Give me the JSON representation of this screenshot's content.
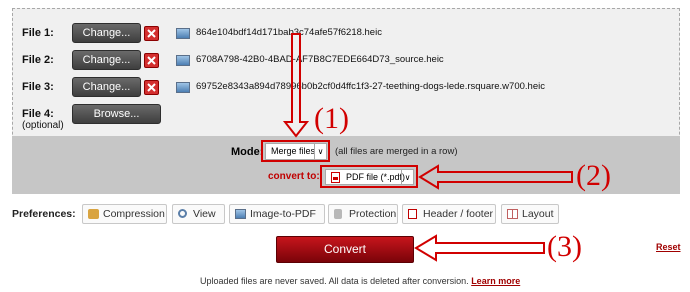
{
  "files": [
    {
      "label": "File 1:",
      "button": "Change...",
      "filename": "864e104bdf14d171bab3c74afe57f6218.heic"
    },
    {
      "label": "File 2:",
      "button": "Change...",
      "filename": "6708A798-42B0-4BAD-AF7B8C7EDE664D73_source.heic"
    },
    {
      "label": "File 3:",
      "button": "Change...",
      "filename": "69752e8343a894d78996b0b2cf0d4ffc1f3-27-teething-dogs-lede.rsquare.w700.heic"
    }
  ],
  "file4": {
    "label": "File 4:",
    "optional": "(optional)",
    "button": "Browse..."
  },
  "mode": {
    "label": "Mode:",
    "selected": "Merge files",
    "caret": "∨",
    "note": "(all files are merged in a row)"
  },
  "convert_to": {
    "label": "convert to:",
    "selected": "PDF file (*.pdf)",
    "caret": "∨"
  },
  "preferences": {
    "label": "Preferences:",
    "items": [
      "Compression",
      "View",
      "Image-to-PDF",
      "Protection",
      "Header / footer",
      "Layout"
    ]
  },
  "actions": {
    "convert": "Convert",
    "reset": "Reset"
  },
  "footer": {
    "text": "Uploaded files are never saved. All data is deleted after conversion.",
    "link": "Learn more"
  },
  "annotations": {
    "one": "(1)",
    "two": "(2)",
    "three": "(3)"
  },
  "colors": {
    "accent_red": "#d10000",
    "convert_red": "#b30f15"
  },
  "icons": {
    "delete": "x-delete-icon",
    "file": "image-file-icon",
    "pdf": "pdf-icon"
  }
}
